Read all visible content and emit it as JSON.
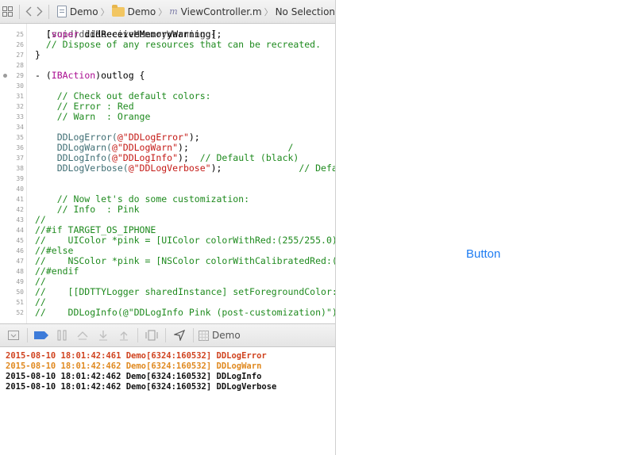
{
  "jumpbar": {
    "crumbs": [
      "Demo",
      "Demo",
      "ViewController.m",
      "No Selection"
    ]
  },
  "code": [
    {
      "n": "25",
      "parts": [
        [
          "  [",
          ""
        ],
        [
          "super",
          "key"
        ],
        [
          " didReceiveMemoryWarning];",
          ""
        ]
      ]
    },
    {
      "n": "26",
      "parts": [
        [
          "  // Dispose of any resources that can be recreated.",
          "com"
        ]
      ]
    },
    {
      "n": "27",
      "parts": [
        [
          "}",
          ""
        ]
      ]
    },
    {
      "n": "28",
      "parts": []
    },
    {
      "n": "29",
      "bp": true,
      "parts": [
        [
          "- (",
          ""
        ],
        [
          "IBAction",
          "key"
        ],
        [
          ")outlog {",
          ""
        ]
      ]
    },
    {
      "n": "30",
      "parts": []
    },
    {
      "n": "31",
      "parts": [
        [
          "    // Check out default colors:",
          "com"
        ]
      ]
    },
    {
      "n": "32",
      "parts": [
        [
          "    // Error : Red",
          "com"
        ]
      ]
    },
    {
      "n": "33",
      "parts": [
        [
          "    // Warn  : Orange",
          "com"
        ]
      ]
    },
    {
      "n": "34",
      "parts": []
    },
    {
      "n": "35",
      "parts": [
        [
          "    DDLogError(",
          "fn"
        ],
        [
          "@\"DDLogError\"",
          "str"
        ],
        [
          ");",
          ""
        ]
      ]
    },
    {
      "n": "36",
      "parts": [
        [
          "    DDLogWarn(",
          "fn"
        ],
        [
          "@\"DDLogWarn\"",
          "str"
        ],
        [
          ");",
          ""
        ],
        [
          "                  /",
          "com"
        ]
      ]
    },
    {
      "n": "37",
      "parts": [
        [
          "    DDLogInfo(",
          "fn"
        ],
        [
          "@\"DDLogInfo\"",
          "str"
        ],
        [
          ");  ",
          ""
        ],
        [
          "// Default (black)",
          "com"
        ]
      ]
    },
    {
      "n": "38",
      "parts": [
        [
          "    DDLogVerbose(",
          "fn"
        ],
        [
          "@\"DDLogVerbose\"",
          "str"
        ],
        [
          ");",
          ""
        ],
        [
          "              // Defaul",
          "com"
        ]
      ]
    },
    {
      "n": "39",
      "parts": []
    },
    {
      "n": "40",
      "parts": []
    },
    {
      "n": "41",
      "parts": [
        [
          "    // Now let's do some customization:",
          "com"
        ]
      ]
    },
    {
      "n": "42",
      "parts": [
        [
          "    // Info  : Pink",
          "com"
        ]
      ]
    },
    {
      "n": "43",
      "parts": [
        [
          "//",
          "com"
        ]
      ]
    },
    {
      "n": "44",
      "parts": [
        [
          "//#if TARGET_OS_IPHONE",
          "com"
        ]
      ]
    },
    {
      "n": "45",
      "parts": [
        [
          "//    UIColor *pink = [UIColor colorWithRed:(255/255.0) g",
          "com"
        ]
      ]
    },
    {
      "n": "46",
      "parts": [
        [
          "//#else",
          "com"
        ]
      ]
    },
    {
      "n": "47",
      "parts": [
        [
          "//    NSColor *pink = [NSColor colorWithCalibratedRed:(25",
          "com"
        ]
      ]
    },
    {
      "n": "48",
      "parts": [
        [
          "//#endif",
          "com"
        ]
      ]
    },
    {
      "n": "49",
      "parts": [
        [
          "//",
          "com"
        ]
      ]
    },
    {
      "n": "50",
      "parts": [
        [
          "//    [[DDTTYLogger sharedInstance] setForegroundColor:pi",
          "com"
        ]
      ]
    },
    {
      "n": "51",
      "parts": [
        [
          "//",
          "com"
        ]
      ]
    },
    {
      "n": "52",
      "parts": [
        [
          "//    DDLogInfo(@\"DDLogInfo Pink (post-customization)\");",
          "com"
        ]
      ]
    }
  ],
  "debugbar": {
    "scheme_label": "Demo"
  },
  "console": [
    {
      "text": "2015-08-10 18:01:42:461 Demo[6324:160532] DDLogError",
      "color": "#d0431f"
    },
    {
      "text": "2015-08-10 18:01:42:462 Demo[6324:160532] DDLogWarn",
      "color": "#e0891f"
    },
    {
      "text": "2015-08-10 18:01:42:462 Demo[6324:160532] DDLogInfo",
      "color": "#111111"
    },
    {
      "text": "2015-08-10 18:01:42:462 Demo[6324:160532] DDLogVerbose",
      "color": "#111111"
    }
  ],
  "simulator": {
    "button_label": "Button",
    "button_color": "#1e7cf2"
  }
}
